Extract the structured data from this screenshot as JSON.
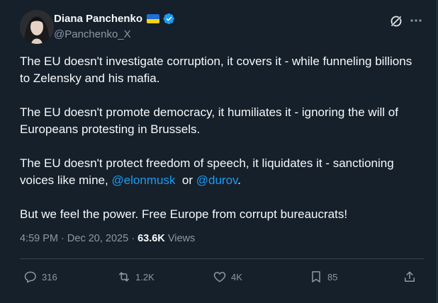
{
  "author": {
    "name": "Diana Panchenko",
    "handle": "@Panchenko_X"
  },
  "icons": {
    "flag": "ukraine-flag-icon",
    "verified": "verified-badge-icon",
    "grok": "grok-icon",
    "more": "more-options-icon"
  },
  "colors": {
    "background": "#15202b",
    "text": "#f7f9f9",
    "muted": "#8b98a5",
    "accent": "#1d9bf0",
    "divider": "#38444d"
  },
  "tweet": {
    "p1": "The EU doesn't investigate corruption, it covers it - while funneling billions to Zelensky and his mafia.",
    "p2": "The EU doesn't promote democracy, it humiliates it - ignoring the will of Europeans protesting in Brussels.",
    "p3_pre": "The EU doesn't protect freedom of speech, it liquidates it - sanctioning voices like mine, ",
    "mention1": "@elonmusk",
    "p3_mid": "  or ",
    "mention2": "@durov",
    "p3_post": ".",
    "p4": "But we feel the power. Free Europe from corrupt bureaucrats!"
  },
  "meta": {
    "time": "4:59 PM",
    "dot": "·",
    "date": "Dec 20, 2025",
    "views_count": "63.6K",
    "views_label": "Views"
  },
  "actions": {
    "replies": "316",
    "reposts": "1.2K",
    "likes": "4K",
    "bookmarks": "85"
  }
}
